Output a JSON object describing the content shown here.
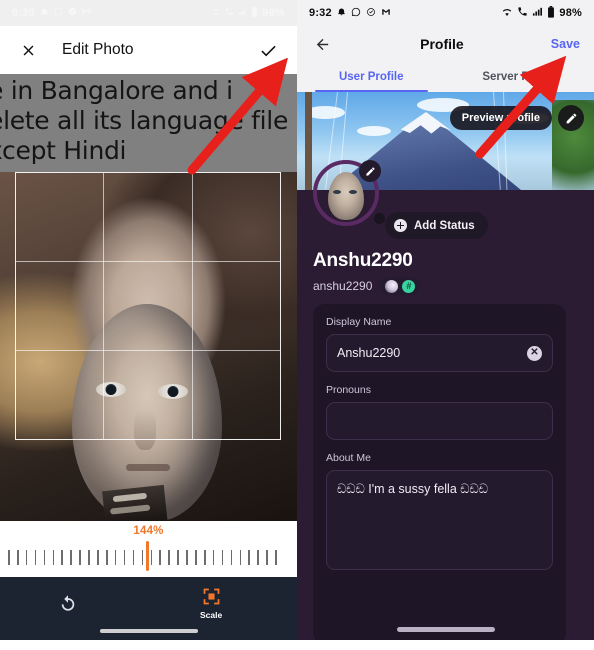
{
  "left_phone": {
    "status_bar": {
      "time": "9:30",
      "battery": "98%",
      "left_icons": [
        "bell-icon",
        "whatsapp-icon",
        "check-circle-icon",
        "gmail-icon"
      ],
      "right_icons": [
        "wifi-icon",
        "call-icon",
        "signal-icon",
        "battery-icon"
      ]
    },
    "appbar": {
      "close_label": "✕",
      "title": "Edit Photo",
      "confirm_label": "✓"
    },
    "underlying_screenshot_text": [
      "e in Bangalore and i",
      "elete all its language file",
      "xcept Hindi"
    ],
    "scale_slider": {
      "value_label": "144%",
      "tick_count": 31,
      "current_tick_index": 15
    },
    "tools": [
      {
        "name": "rotate",
        "icon": "rotate-icon",
        "label": ""
      },
      {
        "name": "scale",
        "icon": "scale-icon",
        "label": "Scale"
      }
    ]
  },
  "right_phone": {
    "status_bar": {
      "time": "9:32",
      "battery": "98%",
      "left_icons": [
        "bell-icon",
        "whatsapp-icon",
        "check-circle-icon",
        "gmail-icon"
      ],
      "right_icons": [
        "wifi-icon",
        "call-icon",
        "signal-icon",
        "battery-icon"
      ]
    },
    "appbar": {
      "back_label": "←",
      "title": "Profile",
      "save_label": "Save"
    },
    "tabs": [
      {
        "label": "User Profile",
        "active": true
      },
      {
        "label": "Server Profile",
        "active": false
      }
    ],
    "banner": {
      "preview_label": "Preview profile",
      "edit_icon": "pencil-icon"
    },
    "avatar": {
      "edit_icon": "pencil-icon",
      "status": "offline"
    },
    "add_status_label": "Add Status",
    "display_name": "Anshu2290",
    "username": "anshu2290",
    "badges": [
      "orb-badge",
      "hash-badge"
    ],
    "badge_hash_symbol": "#",
    "fields": [
      {
        "label": "Display Name",
        "value": "Anshu2290",
        "has_clear": true,
        "clear_glyph": "✕"
      },
      {
        "label": "Pronouns",
        "value": "",
        "has_clear": false
      },
      {
        "label": "About Me",
        "value": "ඩඩඩ I'm a sussy fella ඩඩඩ",
        "has_clear": false
      }
    ]
  },
  "annotations": {
    "arrows": [
      {
        "name": "arrow-to-confirm-check",
        "color": "#e8201c"
      },
      {
        "name": "arrow-to-save-button",
        "color": "#e8201c"
      }
    ]
  },
  "colors": {
    "accent_orange": "#f0772b",
    "discord_blurple": "#5865f2",
    "profile_purple": "#2b1b33",
    "card_purple": "#1e1526",
    "arrow_red": "#e8201c"
  }
}
